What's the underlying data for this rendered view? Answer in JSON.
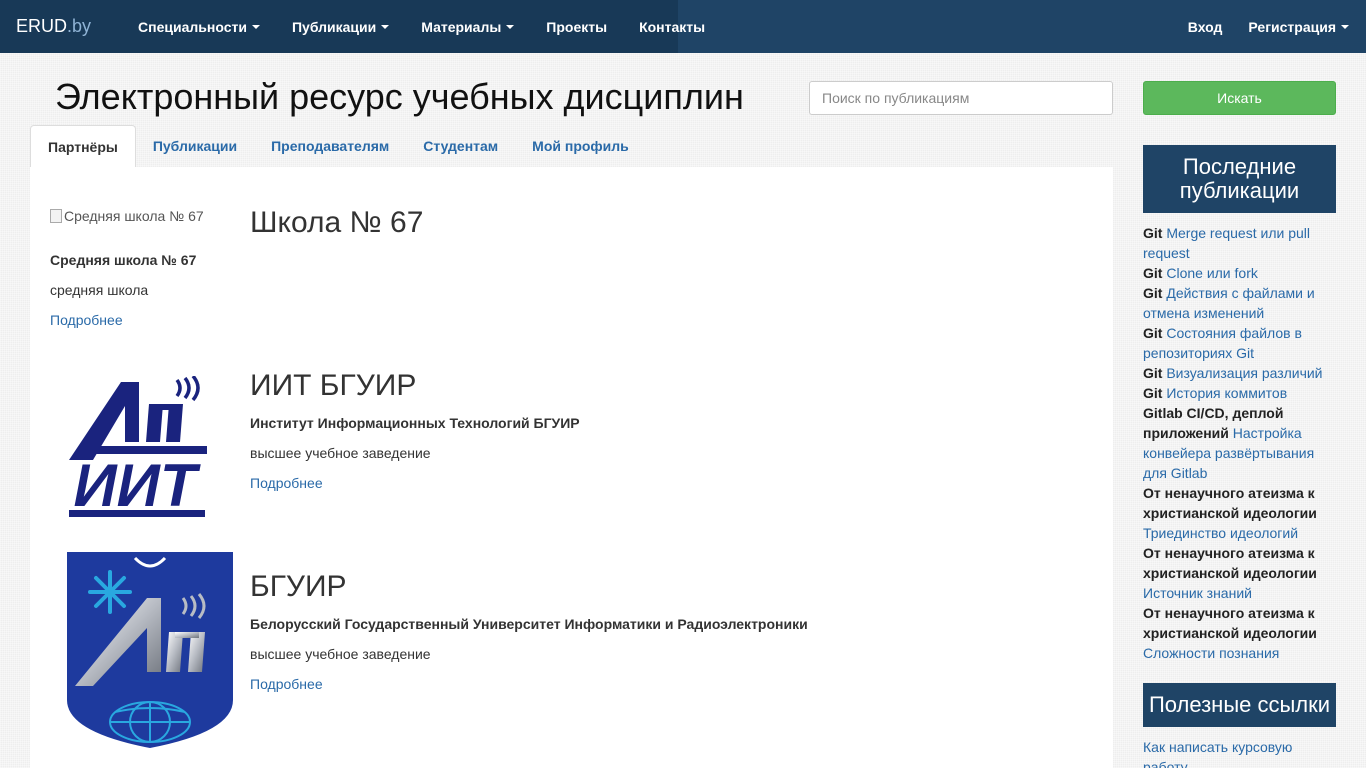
{
  "navbar": {
    "brand_main": "ERUD",
    "brand_suffix": ".by",
    "items": [
      {
        "label": "Специальности"
      },
      {
        "label": "Публикации"
      },
      {
        "label": "Материалы"
      },
      {
        "label": "Проекты"
      },
      {
        "label": "Контакты"
      }
    ],
    "login": "Вход",
    "register": "Регистрация"
  },
  "header": {
    "title": "Электронный ресурс учебных дисциплин",
    "search_placeholder": "Поиск по публикациям",
    "search_button": "Искать"
  },
  "tabs": [
    {
      "label": "Партнёры",
      "active": true
    },
    {
      "label": "Публикации"
    },
    {
      "label": "Преподавателям"
    },
    {
      "label": "Студентам"
    },
    {
      "label": "Мой профиль"
    }
  ],
  "partners": [
    {
      "image_alt": "Средняя школа № 67",
      "title": "Школа № 67",
      "full_name": "Средняя школа № 67",
      "type": "средняя школа",
      "more": "Подробнее"
    },
    {
      "title": "ИИТ БГУИР",
      "full_name": "Институт Информационных Технологий БГУИР",
      "type": "высшее учебное заведение",
      "more": "Подробнее",
      "logo_text": "ИИТ",
      "logo_color": "#1a237e"
    },
    {
      "title": "БГУИР",
      "full_name": "Белорусский Государственный Университет Информатики и Радиоэлектроники",
      "type": "высшее учебное заведение",
      "more": "Подробнее",
      "logo_color": "#1e3a9e"
    }
  ],
  "sidebar": {
    "latest_title": "Последние публикации",
    "latest": [
      {
        "prefix": "Git",
        "link": "Merge request или pull request"
      },
      {
        "prefix": "Git",
        "link": "Clone или fork"
      },
      {
        "prefix": "Git",
        "link": "Действия с файлами и отмена изменений"
      },
      {
        "prefix": "Git",
        "link": "Состояния файлов в репозиториях Git"
      },
      {
        "prefix": "Git",
        "link": "Визуализация различий"
      },
      {
        "prefix": "Git",
        "link": "История коммитов"
      },
      {
        "prefix": "Gitlab CI/CD, деплой приложений",
        "link": "Настройка конвейера развёртывания для Gitlab"
      },
      {
        "prefix": "От ненаучного атеизма к христианской идеологии",
        "link": "Триединство идеологий"
      },
      {
        "prefix": "От ненаучного атеизма к христианской идеологии",
        "link": "Источник знаний"
      },
      {
        "prefix": "От ненаучного атеизма к христианской идеологии",
        "link": "Сложности познания"
      }
    ],
    "useful_title": "Полезные ссылки",
    "useful": [
      {
        "link": "Как написать курсовую работу"
      }
    ]
  },
  "colors": {
    "navbar": "#1f4466",
    "accent_link": "#2a6aa8",
    "success": "#5cb85c"
  }
}
